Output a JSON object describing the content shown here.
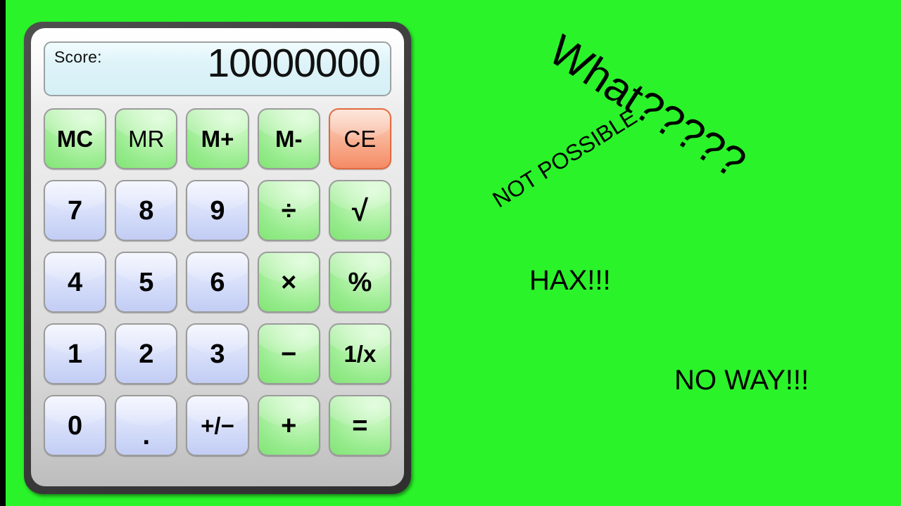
{
  "background": {
    "chroma_color": "#2af32a",
    "letterbox_color": "#000000"
  },
  "calculator": {
    "display": {
      "label": "Score:",
      "value": "10000000",
      "background_color": "#ddf3f8"
    },
    "keys": [
      {
        "label": "MC",
        "name": "memory-clear-button",
        "style": "green",
        "weight": "bold"
      },
      {
        "label": "MR",
        "name": "memory-recall-button",
        "style": "green",
        "weight": "normal"
      },
      {
        "label": "M+",
        "name": "memory-add-button",
        "style": "green",
        "weight": "bold"
      },
      {
        "label": "M-",
        "name": "memory-subtract-button",
        "style": "green",
        "weight": "bold"
      },
      {
        "label": "CE",
        "name": "clear-entry-button",
        "style": "orange",
        "weight": "normal"
      },
      {
        "label": "7",
        "name": "digit-7-button",
        "style": "digit",
        "weight": "bold"
      },
      {
        "label": "8",
        "name": "digit-8-button",
        "style": "digit",
        "weight": "bold"
      },
      {
        "label": "9",
        "name": "digit-9-button",
        "style": "digit",
        "weight": "bold"
      },
      {
        "label": "÷",
        "name": "divide-button",
        "style": "green",
        "weight": "bold"
      },
      {
        "label": "√",
        "name": "square-root-button",
        "style": "green",
        "weight": "bold"
      },
      {
        "label": "4",
        "name": "digit-4-button",
        "style": "digit",
        "weight": "bold"
      },
      {
        "label": "5",
        "name": "digit-5-button",
        "style": "digit",
        "weight": "bold"
      },
      {
        "label": "6",
        "name": "digit-6-button",
        "style": "digit",
        "weight": "bold"
      },
      {
        "label": "×",
        "name": "multiply-button",
        "style": "green",
        "weight": "bold"
      },
      {
        "label": "%",
        "name": "percent-button",
        "style": "green",
        "weight": "bold"
      },
      {
        "label": "1",
        "name": "digit-1-button",
        "style": "digit",
        "weight": "bold"
      },
      {
        "label": "2",
        "name": "digit-2-button",
        "style": "digit",
        "weight": "bold"
      },
      {
        "label": "3",
        "name": "digit-3-button",
        "style": "digit",
        "weight": "bold"
      },
      {
        "label": "−",
        "name": "subtract-button",
        "style": "green",
        "weight": "bold"
      },
      {
        "label": "1/x",
        "name": "reciprocal-button",
        "style": "green",
        "weight": "bold"
      },
      {
        "label": "0",
        "name": "digit-0-button",
        "style": "digit",
        "weight": "bold"
      },
      {
        "label": ".",
        "name": "decimal-point-button",
        "style": "digit",
        "weight": "bold"
      },
      {
        "label": "+/−",
        "name": "sign-toggle-button",
        "style": "digit",
        "weight": "bold"
      },
      {
        "label": "+",
        "name": "add-button",
        "style": "green",
        "weight": "bold"
      },
      {
        "label": "=",
        "name": "equals-button",
        "style": "green",
        "weight": "bold"
      }
    ]
  },
  "annotations": {
    "what": "What?????",
    "not_possible": "NOT POSSIBLE",
    "hax": "HAX!!!",
    "no_way": "NO WAY!!!"
  }
}
